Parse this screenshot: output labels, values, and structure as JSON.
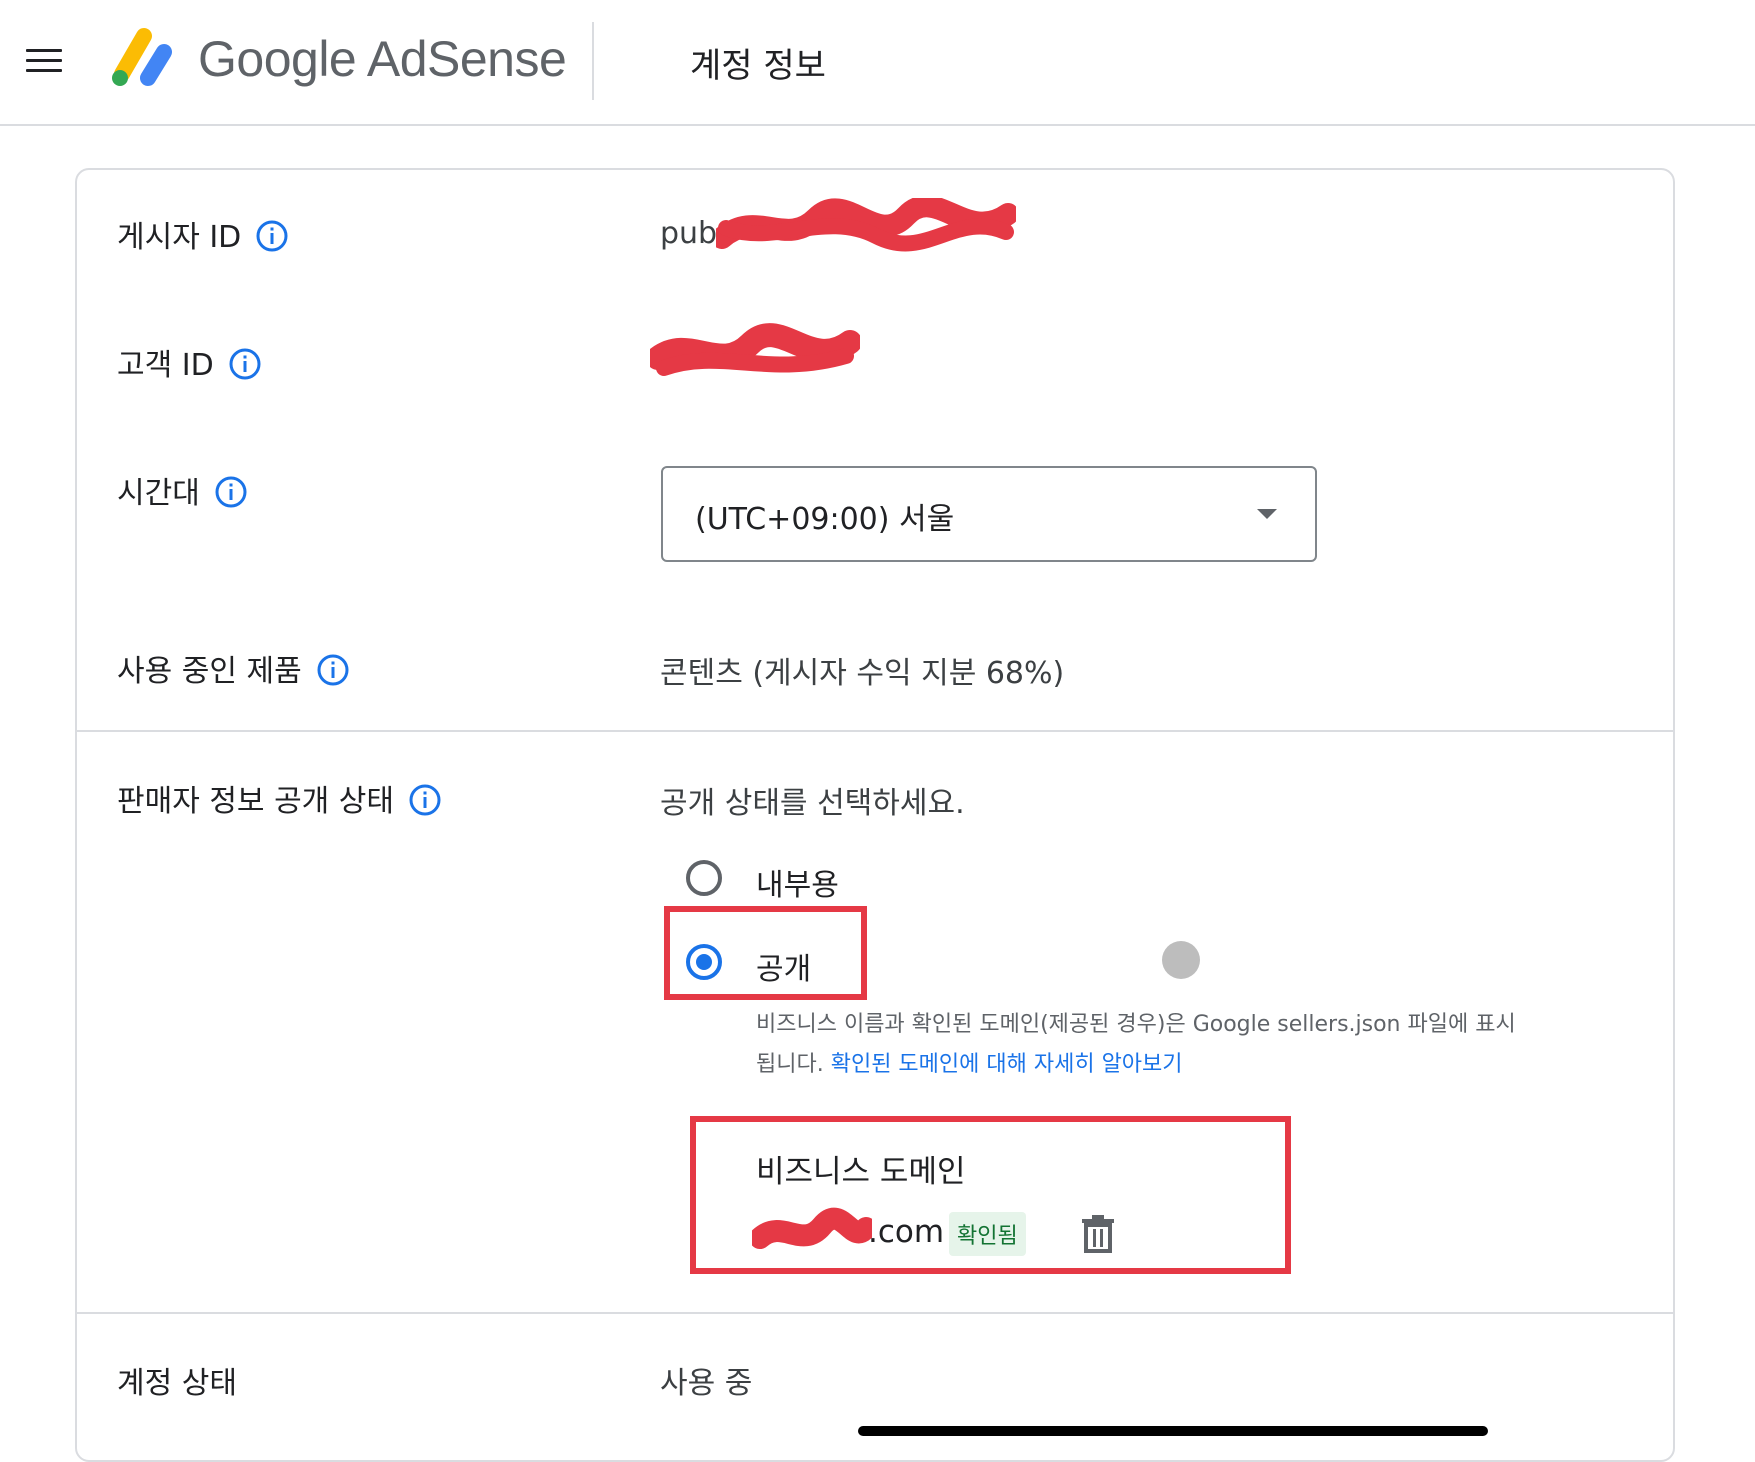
{
  "header": {
    "logo_text": "Google AdSense",
    "page_title": "계정 정보"
  },
  "rows": {
    "publisher_id": {
      "label": "게시자 ID",
      "value_prefix": "pub-"
    },
    "customer_id": {
      "label": "고객 ID"
    },
    "timezone": {
      "label": "시간대",
      "selected": "(UTC+09:00) 서울"
    },
    "products": {
      "label": "사용 중인 제품",
      "value": "콘텐츠 (게시자 수익 지분 68%)"
    },
    "seller_info": {
      "label": "판매자 정보 공개 상태",
      "prompt": "공개 상태를 선택하세요.",
      "options": [
        {
          "label": "내부용",
          "selected": false
        },
        {
          "label": "공개",
          "selected": true
        }
      ],
      "help_line1": "비즈니스 이름과 확인된 도메인(제공된 경우)은 Google sellers.json 파일에 표시",
      "help_line2_prefix": "됩니다. ",
      "help_link": "확인된 도메인에 대해 자세히 알아보기",
      "domain_title": "비즈니스 도메인",
      "domain_suffix": ".com",
      "verified_badge": "확인됨"
    },
    "account_status": {
      "label": "계정 상태",
      "value": "사용 중"
    }
  },
  "colors": {
    "accent": "#1a73e8",
    "highlight": "#e53945",
    "verified_bg": "#e6f4ea",
    "verified_text": "#137333"
  },
  "icons": [
    "menu-icon",
    "adsense-logo-icon",
    "info-icon",
    "dropdown-caret-icon",
    "trash-icon"
  ]
}
